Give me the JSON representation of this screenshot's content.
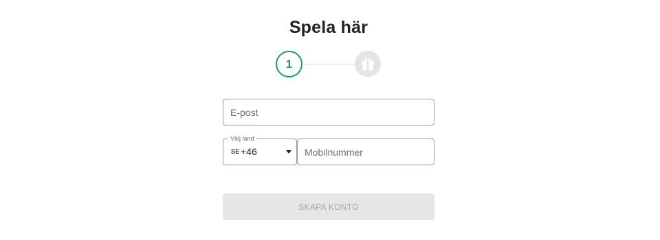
{
  "heading": "Spela här",
  "stepper": {
    "current_step": "1",
    "gift_icon": "gift-icon",
    "active_color": "#1aa05a"
  },
  "form": {
    "email_placeholder": "E-post",
    "country": {
      "legend": "Välj land",
      "code": "SE",
      "dial_code": "+46",
      "arrow_icon": "caret-down-icon"
    },
    "phone_placeholder": "Mobilnummer",
    "submit_label": "SKAPA KONTO"
  }
}
